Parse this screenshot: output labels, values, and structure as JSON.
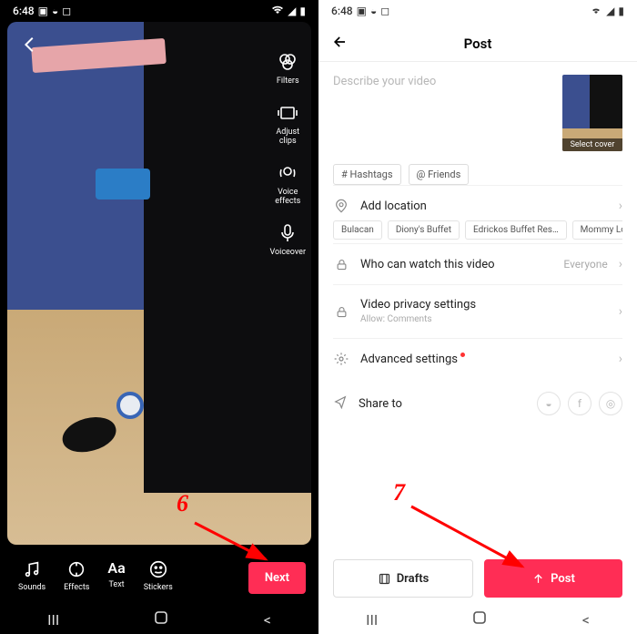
{
  "status": {
    "time": "6:48",
    "left_icons": [
      "image",
      "messenger",
      "square"
    ],
    "right_icons": [
      "wifi",
      "signal",
      "battery"
    ]
  },
  "left": {
    "side_tools": [
      {
        "name": "filters",
        "label": "Filters"
      },
      {
        "name": "adjust-clips",
        "label": "Adjust\nclips"
      },
      {
        "name": "voice-effects",
        "label": "Voice\neffects"
      },
      {
        "name": "voiceover",
        "label": "Voiceover"
      }
    ],
    "editor_tools": [
      {
        "name": "sounds",
        "label": "Sounds"
      },
      {
        "name": "effects",
        "label": "Effects"
      },
      {
        "name": "text",
        "label": "Text"
      },
      {
        "name": "stickers",
        "label": "Stickers"
      }
    ],
    "next": "Next",
    "step": "6"
  },
  "right": {
    "title": "Post",
    "describe_placeholder": "Describe your video",
    "thumb_caption": "Select cover",
    "chips": {
      "hashtags": "# Hashtags",
      "friends": "@ Friends"
    },
    "location": {
      "label": "Add location",
      "suggestions": [
        "Bulacan",
        "Diony's Buffet",
        "Edrickos Buffet Res…",
        "Mommy Lou's & I"
      ]
    },
    "privacy_watch": {
      "label": "Who can watch this video",
      "value": "Everyone"
    },
    "privacy_settings": {
      "label": "Video privacy settings",
      "sub": "Allow: Comments"
    },
    "advanced": "Advanced settings",
    "share": "Share to",
    "drafts": "Drafts",
    "post": "Post",
    "step": "7"
  }
}
